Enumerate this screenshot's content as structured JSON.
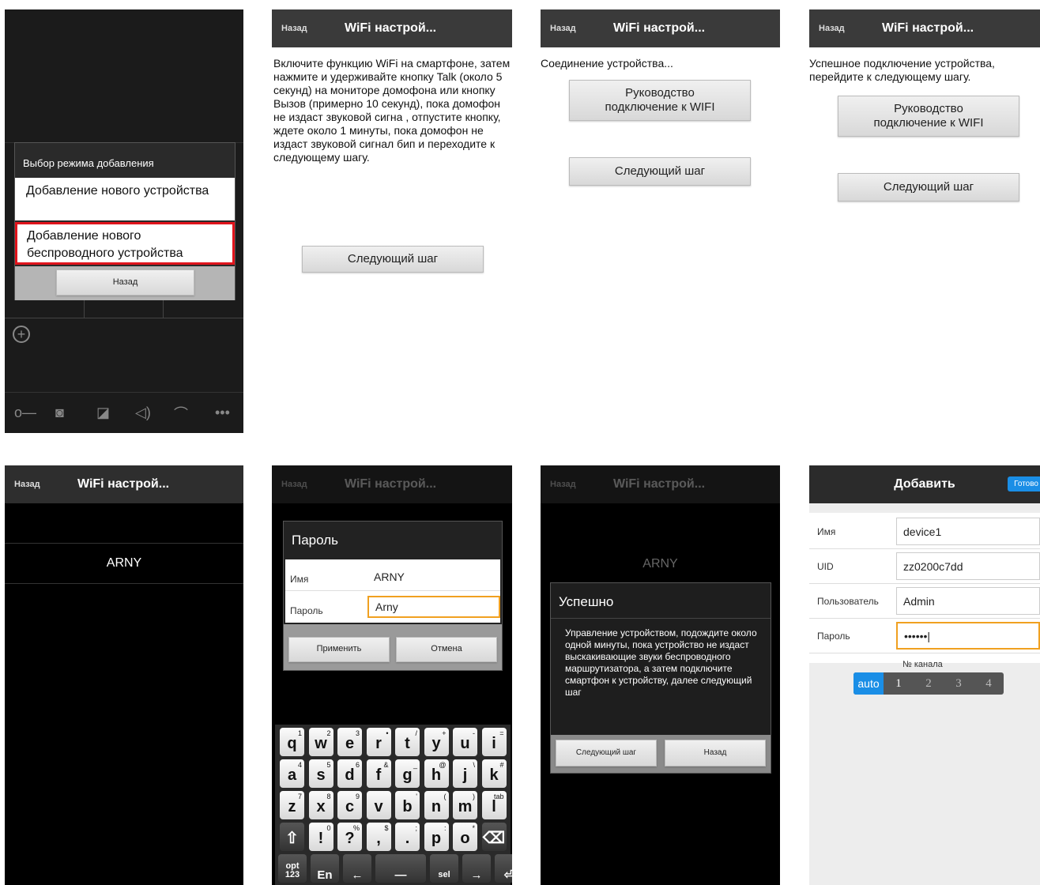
{
  "panel1": {
    "dialog_title": "Выбор режима добавления",
    "option1": "Добавление нового устройства",
    "option2": "Добавление нового беспроводного устройства",
    "back_button": "Назад"
  },
  "header": {
    "back_label": "Назад",
    "title": "WiFi настрой..."
  },
  "panel2": {
    "instruction": "Включите функцию WiFi на смартфоне, затем нажмите и удерживайте кнопку Talk (около 5 секунд) на мониторе домофона или кнопку Вызов (примерно 10 секунд), пока домофон не издаст звуковой сигна , отпустите кнопку, ждете около 1 минуты, пока домофон не издаст звуковой сигнал бип и переходите к следующему шагу.",
    "next_button": "Следующий шаг"
  },
  "panel3": {
    "status": "Соединение устройства...",
    "guide_button": "Руководство подключение к WIFI",
    "next_button": "Следующий шаг"
  },
  "panel4": {
    "status": "Успешное подключение устройства, перейдите к следующему шагу.",
    "guide_button": "Руководство подключение к WIFI",
    "next_button": "Следующий шаг"
  },
  "panel5": {
    "network": "ARNY"
  },
  "panel6": {
    "dialog_title": "Пароль",
    "name_label": "Имя",
    "name_value": "ARNY",
    "password_label": "Пароль",
    "password_value": "Arny",
    "apply_button": "Применить",
    "cancel_button": "Отмена",
    "keyboard": {
      "row1": [
        "q",
        "w",
        "e",
        "r",
        "t",
        "y",
        "u",
        "i"
      ],
      "row1_sup": [
        "1",
        "2",
        "3",
        "•",
        "/",
        "+",
        "-",
        "="
      ],
      "row2": [
        "a",
        "s",
        "d",
        "f",
        "g",
        "h",
        "j",
        "k"
      ],
      "row2_sup": [
        "4",
        "5",
        "6",
        "&",
        "_",
        "@",
        "\\",
        "#"
      ],
      "row3": [
        "z",
        "x",
        "c",
        "v",
        "b",
        "n",
        "m",
        "l"
      ],
      "row3_sup": [
        "7",
        "8",
        "9",
        "",
        "'",
        "(",
        ")",
        "tab"
      ],
      "row4": [
        "⇧",
        "!",
        "?",
        ",",
        ".",
        "p",
        "o",
        "⌫"
      ],
      "row4_sup": [
        "",
        "0",
        "%",
        "$",
        ";",
        ":",
        "*",
        ""
      ],
      "row5": [
        "opt 123",
        "En",
        "←",
        "—",
        "sel",
        "→",
        "⏎"
      ]
    }
  },
  "panel7": {
    "network": "ARNY",
    "dialog_title": "Успешно",
    "message": "Управление устройством, подождите около одной минуты, пока устройство не издаст выскакивающие звуки беспроводного маршрутизатора, а затем подключите смартфон к устройству, далее следующий шаг",
    "next_button": "Следующий шаг",
    "back_button": "Назад"
  },
  "panel8": {
    "title": "Добавить",
    "done_button": "Готово",
    "fields": [
      {
        "label": "Имя",
        "value": "device1"
      },
      {
        "label": "UID",
        "value": "zz0200c7dd"
      },
      {
        "label": "Пользователь",
        "value": "Admin"
      },
      {
        "label": "Пароль",
        "value": "••••••|"
      }
    ],
    "channel_label": "№ канала",
    "channels": [
      "auto",
      "1",
      "2",
      "3",
      "4"
    ]
  }
}
